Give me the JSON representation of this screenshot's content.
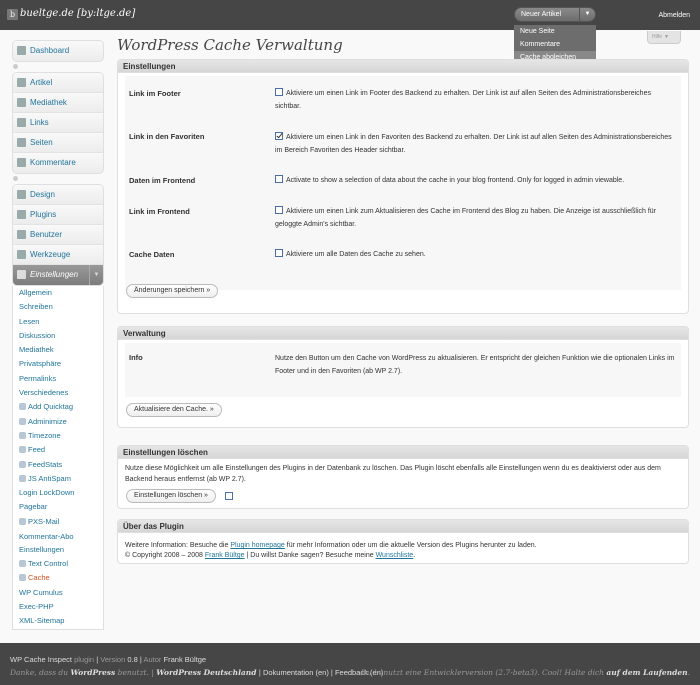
{
  "header": {
    "logo_glyph": "b",
    "site_title": "bueltge.de [by:ltge.de]",
    "favorite_label": "Neuer Artikel",
    "favorite_toggle": "▼",
    "favorite_items": [
      "Neue Seite",
      "Kommentare",
      "Cache abgleichen"
    ],
    "logout": "Abmelden"
  },
  "menu": {
    "dashboard": "Dashboard",
    "content": [
      "Artikel",
      "Mediathek",
      "Links",
      "Seiten",
      "Kommentare"
    ],
    "tools": [
      "Design",
      "Plugins",
      "Benutzer",
      "Werkzeuge"
    ],
    "settings": "Einstellungen",
    "settings_toggle": "▼",
    "submenu": [
      "Allgemein",
      "Schreiben",
      "Lesen",
      "Diskussion",
      "Mediathek",
      "Privatsphäre",
      "Permalinks",
      "Verschiedenes",
      "Add Quicktag",
      "Adminimize",
      "Timezone",
      "Feed",
      "FeedStats",
      "JS AntiSpam",
      "Login LockDown",
      "Pagebar",
      "PXS-Mail",
      "Kommentar-Abo Einstellungen",
      "Text Control",
      "Cache",
      "WP Cumulus",
      "Exec-PHP",
      "XML-Sitemap"
    ]
  },
  "page": {
    "title": "WordPress Cache Verwaltung",
    "help": "Hilfe",
    "help_arrow": "▼"
  },
  "settings_box": {
    "heading": "Einstellungen",
    "rows": [
      {
        "label": "Link im Footer",
        "text": "Aktiviere um einen Link im Footer des Backend zu erhalten. Der Link ist auf allen Seiten des Administrationsbereiches sichtbar.",
        "checked": false
      },
      {
        "label": "Link in den Favoriten",
        "text": "Aktiviere um einen Link in den Favoriten des Backend zu erhalten. Der Link ist auf allen Seiten des Administrationsbereiches im Bereich Favoriten des Header sichtbar.",
        "checked": true
      },
      {
        "label": "Daten im Frontend",
        "text": "Activate to show a selection of data about the cache in your blog frontend. Only for logged in admin viewable.",
        "checked": false
      },
      {
        "label": "Link im Frontend",
        "text": "Aktiviere um einen Link zum Aktualisieren des Cache im Frontend des Blog zu haben. Die Anzeige ist ausschließlich für geloggte Admin's sichtbar.",
        "checked": false
      },
      {
        "label": "Cache Daten",
        "text": "Aktiviere um alle Daten des Cache zu sehen.",
        "checked": false
      }
    ],
    "save_button": "Änderungen speichern »"
  },
  "manage_box": {
    "heading": "Verwaltung",
    "label": "Info",
    "text": "Nutze den Button um den Cache von WordPress zu aktualisieren. Er entspricht der gleichen Funktion wie die optionalen Links im Footer und in den Favoriten (ab WP 2.7).",
    "button": "Aktualisiere den Cache. »"
  },
  "delete_box": {
    "heading": "Einstellungen löschen",
    "text": "Nutze diese Möglichkeit um alle Einstellungen des Plugins in der Datenbank zu löschen. Das Plugin löscht ebenfalls alle Einstellungen wenn du es deaktivierst oder aus dem Backend heraus entfernst (ab WP 2.7).",
    "button": "Einstellungen löschen »"
  },
  "about_box": {
    "heading": "Über das Plugin",
    "line1_pre": "Weitere Information: Besuche die ",
    "line1_link": "Plugin homepage",
    "line1_post": " für mehr Information oder um die aktuelle Version des Plugins herunter zu laden.",
    "line2_pre": "© Copyright 2008 – 2008 ",
    "line2_link": "Frank Bültge",
    "line2_mid": " | Du willst Danke sagen? Besuche meine ",
    "line2_link2": "Wunschliste",
    "line2_post": "."
  },
  "footer": {
    "plugin_name": "WP Cache Inspect",
    "plugin_word": "plugin",
    "version_label": "Version",
    "version": "0.8",
    "author_label": "Autor",
    "author": "Frank Bültge",
    "thanks_pre": "Danke, dass du ",
    "thanks_wp": "WordPress",
    "thanks_post": " benutzt. | ",
    "wp_de": "WordPress Deutschland",
    "doc": "Dokumentation",
    "doc_lang": "(en)",
    "feedback": "Feedback",
    "feedback_lang": "(en)",
    "dev_pre": "Du benutzt eine Entwicklerversion (2.7-beta3). Cool! Halte dich ",
    "dev_link": "auf dem Laufenden",
    "dev_post": "."
  }
}
